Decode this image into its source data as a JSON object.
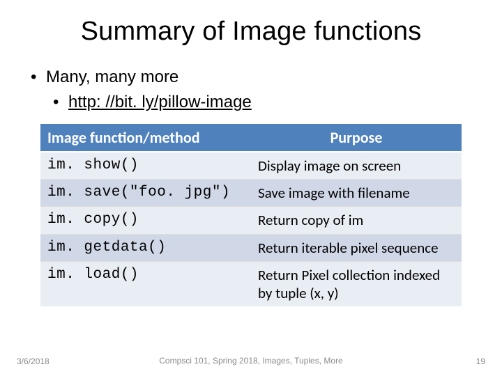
{
  "title": "Summary of Image functions",
  "bullets": {
    "line1": "Many, many more",
    "link_text": "http: //bit. ly/pillow-image",
    "link_href": "http://bit.ly/pillow-image"
  },
  "table": {
    "headers": {
      "col1": "Image function/method",
      "col2": "Purpose"
    },
    "rows": [
      {
        "fn": "im. show()",
        "purpose": "Display image on screen"
      },
      {
        "fn": "im. save(\"foo. jpg\")",
        "purpose": "Save image with filename"
      },
      {
        "fn": "im. copy()",
        "purpose": "Return copy of im"
      },
      {
        "fn": "im. getdata()",
        "purpose": "Return iterable pixel sequence"
      },
      {
        "fn": "im. load()",
        "purpose": "Return Pixel collection indexed by tuple (x, y)"
      }
    ]
  },
  "footer": {
    "date": "3/6/2018",
    "center": "Compsci 101, Spring 2018,  Images, Tuples, More",
    "page": "19"
  }
}
